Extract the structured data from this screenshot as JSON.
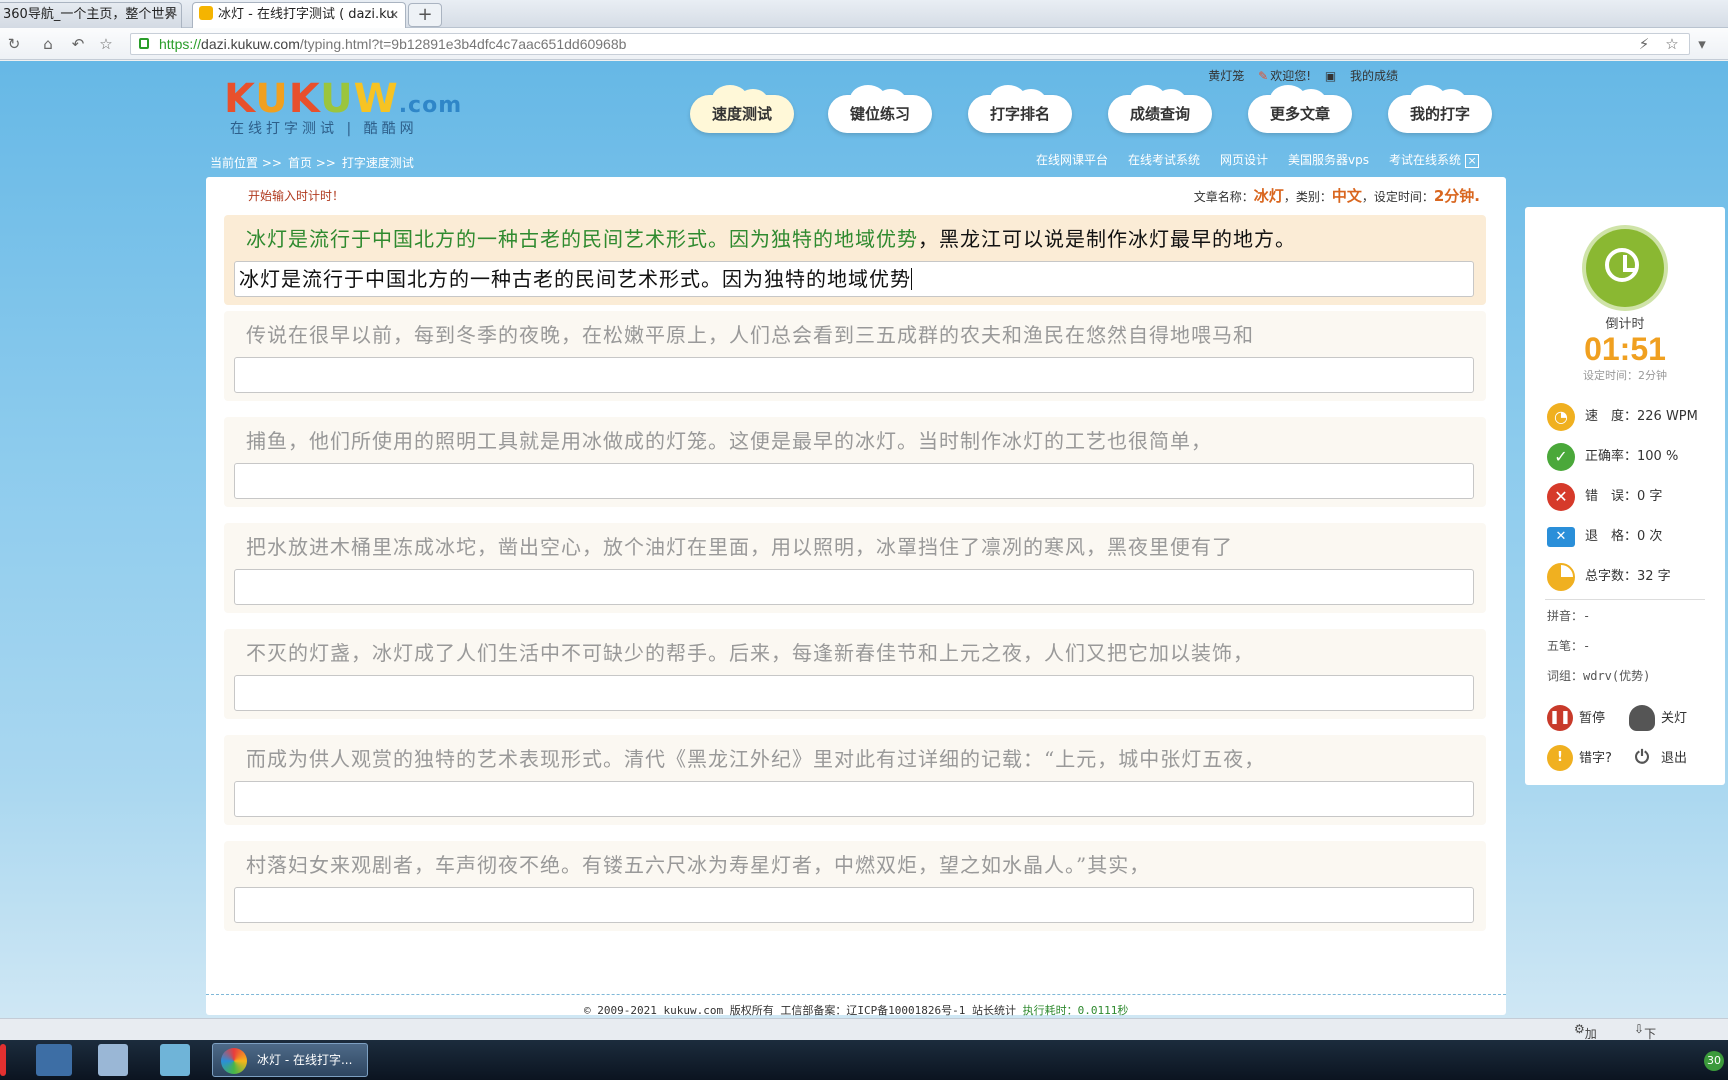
{
  "browser": {
    "tabs": [
      {
        "title": "360导航_一个主页，整个世界",
        "active": false
      },
      {
        "title": "冰灯 - 在线打字测试 ( dazi.ku",
        "active": true
      }
    ],
    "new_tab": "+",
    "url_scheme": "https://",
    "url_host": "dazi.kukuw.com",
    "url_path": "/typing.html?t=9b12891e3b4dfc4c7aac651dd60968b"
  },
  "header": {
    "logo": {
      "k": "K",
      "u1": "U",
      "k2": "K",
      "u2": "U",
      "w": "W",
      "dotcom": ".com"
    },
    "logo_sub": "在线打字测试 | 酷酷网",
    "user": {
      "name": "黄灯笼",
      "welcome": "欢迎您!",
      "my_scores": "我的成绩"
    },
    "nav": [
      "速度测试",
      "键位练习",
      "打字排名",
      "成绩查询",
      "更多文章",
      "我的打字"
    ],
    "breadcrumb": [
      "当前位置 >>",
      "首页 >>",
      "打字速度测试"
    ],
    "sublinks": [
      "在线网课平台",
      "在线考试系统",
      "网页设计",
      "美国服务器vps",
      "考试在线系统"
    ],
    "sublinks_close": "×"
  },
  "main": {
    "hint": "开始输入时计时！",
    "meta": {
      "article_label": "文章名称：",
      "article": "冰灯",
      "category_label": "，类别：",
      "category": "中文",
      "time_label": "，设定时间：",
      "time": "2分钟."
    },
    "lines": [
      {
        "typed": "冰灯是流行于中国北方的一种古老的民间艺术形式。因为独特的地域优势",
        "rest": "，黑龙江可以说是制作冰灯最早的地方。",
        "input": "冰灯是流行于中国北方的一种古老的民间艺术形式。因为独特的地域优势"
      },
      {
        "typed": "",
        "rest": "传说在很早以前，每到冬季的夜晚，在松嫩平原上，人们总会看到三五成群的农夫和渔民在悠然自得地喂马和",
        "input": ""
      },
      {
        "typed": "",
        "rest": "捕鱼，他们所使用的照明工具就是用冰做成的灯笼。这便是最早的冰灯。当时制作冰灯的工艺也很简单，",
        "input": ""
      },
      {
        "typed": "",
        "rest": "把水放进木桶里冻成冰坨，凿出空心，放个油灯在里面，用以照明，冰罩挡住了凛冽的寒风，黑夜里便有了",
        "input": ""
      },
      {
        "typed": "",
        "rest": "不灭的灯盏，冰灯成了人们生活中不可缺少的帮手。后来，每逢新春佳节和上元之夜，人们又把它加以装饰，",
        "input": ""
      },
      {
        "typed": "",
        "rest": "而成为供人观赏的独特的艺术表现形式。清代《黑龙江外纪》里对此有过详细的记载：“上元，城中张灯五夜，",
        "input": ""
      },
      {
        "typed": "",
        "rest": "村落妇女来观剧者，车声彻夜不绝。有镂五六尺冰为寿星灯者，中燃双炬，望之如水晶人。”其实，",
        "input": ""
      }
    ]
  },
  "side": {
    "countdown_label": "倒计时",
    "countdown": "01:51",
    "set_time": "设定时间：2分钟",
    "stats": [
      {
        "label": "速　度：226 WPM",
        "icon": "speedometer-icon",
        "color": "#f0b020"
      },
      {
        "label": "正确率：100 %",
        "icon": "check-icon",
        "color": "#4aa83a"
      },
      {
        "label": "错　误：0 字",
        "icon": "error-icon",
        "color": "#d63a2a"
      },
      {
        "label": "退　格：0 次",
        "icon": "backspace-icon",
        "color": "#2a8fd9"
      },
      {
        "label": "总字数：32 字",
        "icon": "pie-icon",
        "color": "#f0b020"
      }
    ],
    "pinyin": "拼音：-",
    "wubi": "五笔：-",
    "cizu": "词组：wdrv(优势)",
    "buttons": {
      "pause": "暂停",
      "light": "关灯",
      "typo": "错字?",
      "exit": "退出"
    }
  },
  "footer": {
    "copyright": "© 2009-2021 kukuw.com 版权所有 工信部备案：辽ICP备10001826号-1 站长统计",
    "exec_time": "执行耗时：0.0111秒"
  },
  "statusbar": {
    "accelerator": "加速器",
    "download": "下载"
  },
  "taskbar": {
    "app": "冰灯 - 在线打字...",
    "clock": "30"
  }
}
